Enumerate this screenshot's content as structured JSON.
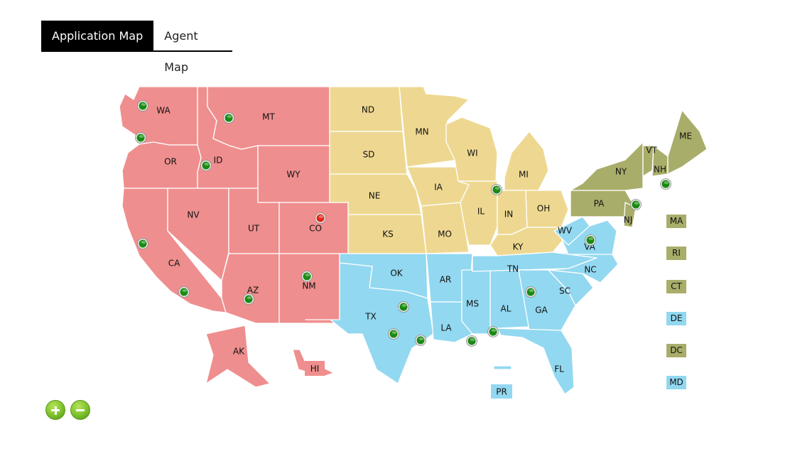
{
  "tabs": [
    {
      "label": "Application Map",
      "active": true
    },
    {
      "label": "Agent Map",
      "active": false
    }
  ],
  "region_colors": {
    "west": "#ef8e8e",
    "midwest": "#eed891",
    "south": "#92d8f0",
    "northeast": "#a9ad6a"
  },
  "marker_colors": {
    "ok": "#1a8a12",
    "alert": "#e32618"
  },
  "states": [
    {
      "code": "WA",
      "region": "west"
    },
    {
      "code": "OR",
      "region": "west"
    },
    {
      "code": "CA",
      "region": "west"
    },
    {
      "code": "ID",
      "region": "west"
    },
    {
      "code": "NV",
      "region": "west"
    },
    {
      "code": "MT",
      "region": "west"
    },
    {
      "code": "WY",
      "region": "west"
    },
    {
      "code": "UT",
      "region": "west"
    },
    {
      "code": "AZ",
      "region": "west"
    },
    {
      "code": "CO",
      "region": "west"
    },
    {
      "code": "NM",
      "region": "west"
    },
    {
      "code": "AK",
      "region": "west"
    },
    {
      "code": "HI",
      "region": "west"
    },
    {
      "code": "ND",
      "region": "midwest"
    },
    {
      "code": "SD",
      "region": "midwest"
    },
    {
      "code": "NE",
      "region": "midwest"
    },
    {
      "code": "KS",
      "region": "midwest"
    },
    {
      "code": "MN",
      "region": "midwest"
    },
    {
      "code": "IA",
      "region": "midwest"
    },
    {
      "code": "MO",
      "region": "midwest"
    },
    {
      "code": "WI",
      "region": "midwest"
    },
    {
      "code": "IL",
      "region": "midwest"
    },
    {
      "code": "MI",
      "region": "midwest"
    },
    {
      "code": "IN",
      "region": "midwest"
    },
    {
      "code": "OH",
      "region": "midwest"
    },
    {
      "code": "KY",
      "region": "midwest"
    },
    {
      "code": "OK",
      "region": "south"
    },
    {
      "code": "TX",
      "region": "south"
    },
    {
      "code": "AR",
      "region": "south"
    },
    {
      "code": "LA",
      "region": "south"
    },
    {
      "code": "MS",
      "region": "south"
    },
    {
      "code": "AL",
      "region": "south"
    },
    {
      "code": "TN",
      "region": "south"
    },
    {
      "code": "GA",
      "region": "south"
    },
    {
      "code": "FL",
      "region": "south"
    },
    {
      "code": "SC",
      "region": "south"
    },
    {
      "code": "NC",
      "region": "south"
    },
    {
      "code": "VA",
      "region": "south"
    },
    {
      "code": "WV",
      "region": "south"
    },
    {
      "code": "PR",
      "region": "south"
    },
    {
      "code": "PA",
      "region": "northeast"
    },
    {
      "code": "NY",
      "region": "northeast"
    },
    {
      "code": "NJ",
      "region": "northeast"
    },
    {
      "code": "VT",
      "region": "northeast"
    },
    {
      "code": "NH",
      "region": "northeast"
    },
    {
      "code": "ME",
      "region": "northeast"
    }
  ],
  "side_labels": [
    {
      "code": "MA",
      "region": "northeast"
    },
    {
      "code": "RI",
      "region": "northeast"
    },
    {
      "code": "CT",
      "region": "northeast"
    },
    {
      "code": "DE",
      "region": "south"
    },
    {
      "code": "DC",
      "region": "northeast"
    },
    {
      "code": "MD",
      "region": "south"
    }
  ],
  "markers": [
    {
      "state": "WA",
      "status": "ok"
    },
    {
      "state": "OR",
      "status": "ok"
    },
    {
      "state": "MT",
      "status": "ok"
    },
    {
      "state": "ID",
      "status": "ok"
    },
    {
      "state": "CA",
      "status": "ok"
    },
    {
      "state": "CA",
      "status": "ok"
    },
    {
      "state": "AZ",
      "status": "ok"
    },
    {
      "state": "NM",
      "status": "ok"
    },
    {
      "state": "CO",
      "status": "alert"
    },
    {
      "state": "IL",
      "status": "ok"
    },
    {
      "state": "TX",
      "status": "ok"
    },
    {
      "state": "TX",
      "status": "ok"
    },
    {
      "state": "TX",
      "status": "ok"
    },
    {
      "state": "LA",
      "status": "ok"
    },
    {
      "state": "AL",
      "status": "ok"
    },
    {
      "state": "GA",
      "status": "ok"
    },
    {
      "state": "VA",
      "status": "ok"
    },
    {
      "state": "NY",
      "status": "ok"
    },
    {
      "state": "MA",
      "status": "ok"
    }
  ],
  "zoom_controls": {
    "zoom_in": "zoom-in",
    "zoom_out": "zoom-out"
  }
}
